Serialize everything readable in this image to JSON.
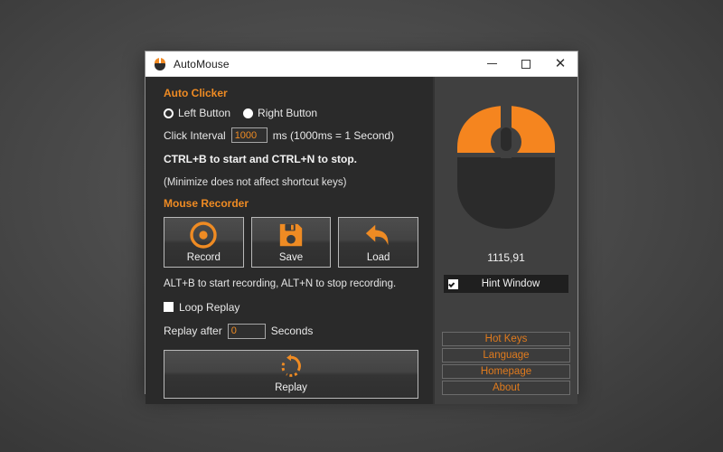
{
  "window": {
    "title": "AutoMouse",
    "app_icon": "mouse-icon",
    "minimize_label": "–",
    "maximize_label": "□",
    "close_label": "✕"
  },
  "auto_clicker": {
    "section_title": "Auto Clicker",
    "left_button_label": "Left Button",
    "right_button_label": "Right Button",
    "left_button_selected": false,
    "right_button_selected": true,
    "interval_label": "Click Interval",
    "interval_value": "1000",
    "interval_suffix": "ms (1000ms = 1 Second)",
    "shortcut_note": "CTRL+B to start and CTRL+N to stop.",
    "minimize_note": "(Minimize does not affect shortcut keys)"
  },
  "mouse_recorder": {
    "section_title": "Mouse Recorder",
    "buttons": [
      {
        "label": "Record",
        "icon": "record-circle-icon"
      },
      {
        "label": "Save",
        "icon": "floppy-disk-icon"
      },
      {
        "label": "Load",
        "icon": "curved-back-arrow-icon"
      }
    ],
    "shortcut_note": "ALT+B to start recording, ALT+N to stop recording.",
    "loop_replay_label": "Loop Replay",
    "loop_replay_checked": false,
    "replay_after_label": "Replay after",
    "replay_after_value": "0",
    "replay_after_suffix": "Seconds",
    "replay_button_label": "Replay",
    "replay_button_icon": "circular-arrow-icon"
  },
  "right_panel": {
    "mouse_graphic": "mouse-illustration",
    "coordinates": "1115,91",
    "hint_window_label": "Hint Window",
    "hint_window_checked": true,
    "links": [
      {
        "label": "Hot Keys"
      },
      {
        "label": "Language"
      },
      {
        "label": "Homepage"
      },
      {
        "label": "About"
      }
    ]
  },
  "colors": {
    "accent_orange": "#ef8b23",
    "link_orange": "#e07b1e",
    "left_panel_bg": "#2a2a2a",
    "right_panel_bg": "#404040",
    "titlebar_bg": "#ffffff"
  }
}
